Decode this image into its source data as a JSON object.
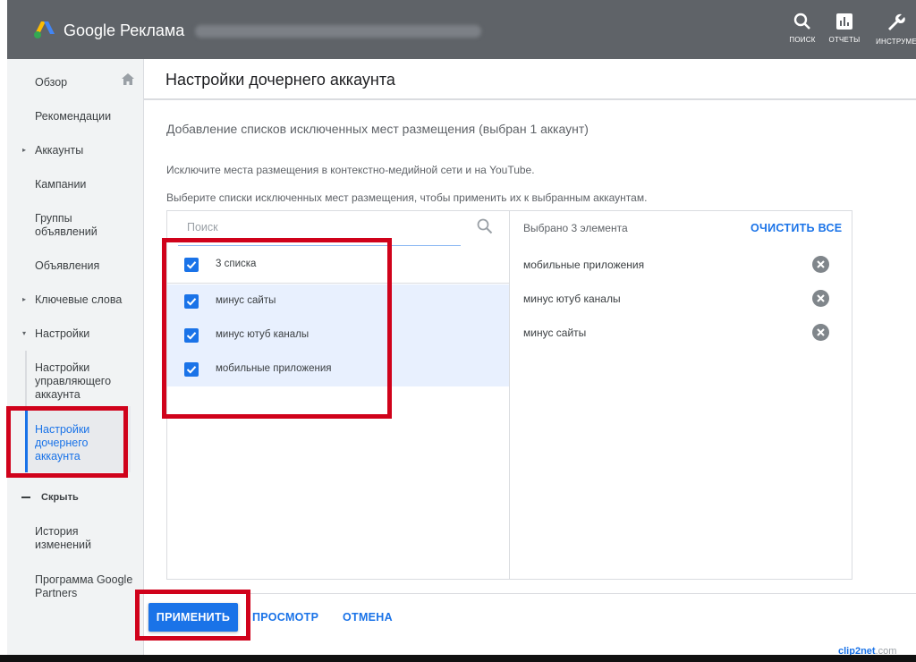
{
  "topbar": {
    "brand": "Google Реклама",
    "tools": [
      {
        "label": "ПОИСК",
        "icon": "search-icon"
      },
      {
        "label": "ОТЧЕТЫ",
        "icon": "reports-icon"
      },
      {
        "label": "ИНСТРУМЕ",
        "icon": "wrench-icon"
      }
    ]
  },
  "sidebar": {
    "items": [
      {
        "label": "Обзор"
      },
      {
        "label": "Рекомендации"
      },
      {
        "label": "Аккаунты"
      },
      {
        "label": "Кампании"
      },
      {
        "label": "Группы объявлений"
      },
      {
        "label": "Объявления"
      },
      {
        "label": "Ключевые слова"
      },
      {
        "label": "Настройки"
      },
      {
        "label": "Настройки управляющего аккаунта"
      },
      {
        "label": "Настройки дочернего аккаунта"
      },
      {
        "label": "Скрыть"
      },
      {
        "label": "История изменений"
      },
      {
        "label": "Программа Google Partners"
      }
    ]
  },
  "main": {
    "title": "Настройки дочернего аккаунта",
    "section_title": "Добавление списков исключенных мест размещения (выбран 1 аккаунт)",
    "desc1": "Исключите места размещения в контекстно-медийной сети и на YouTube.",
    "desc2": "Выберите списки исключенных мест размещения, чтобы применить их к выбранным аккаунтам.",
    "picker": {
      "search_placeholder": "Поиск",
      "header_label": "3 списка",
      "options": [
        {
          "label": "минус сайты",
          "checked": true
        },
        {
          "label": "минус ютуб каналы",
          "checked": true
        },
        {
          "label": "мобильные приложения",
          "checked": true
        }
      ],
      "selected_count": "Выбрано 3 элемента",
      "clear_all": "ОЧИСТИТЬ ВСЕ",
      "selected": [
        {
          "label": "мобильные приложения"
        },
        {
          "label": "минус ютуб каналы"
        },
        {
          "label": "минус сайты"
        }
      ]
    },
    "buttons": {
      "apply": "ПРИМЕНИТЬ",
      "preview": "ПРОСМОТР",
      "cancel": "ОТМЕНА"
    }
  },
  "watermark": {
    "main": "clip2net",
    "suffix": ".com"
  },
  "colors": {
    "accent": "#1a73e8",
    "highlight": "#d0021b",
    "topbar": "#5f6368"
  }
}
